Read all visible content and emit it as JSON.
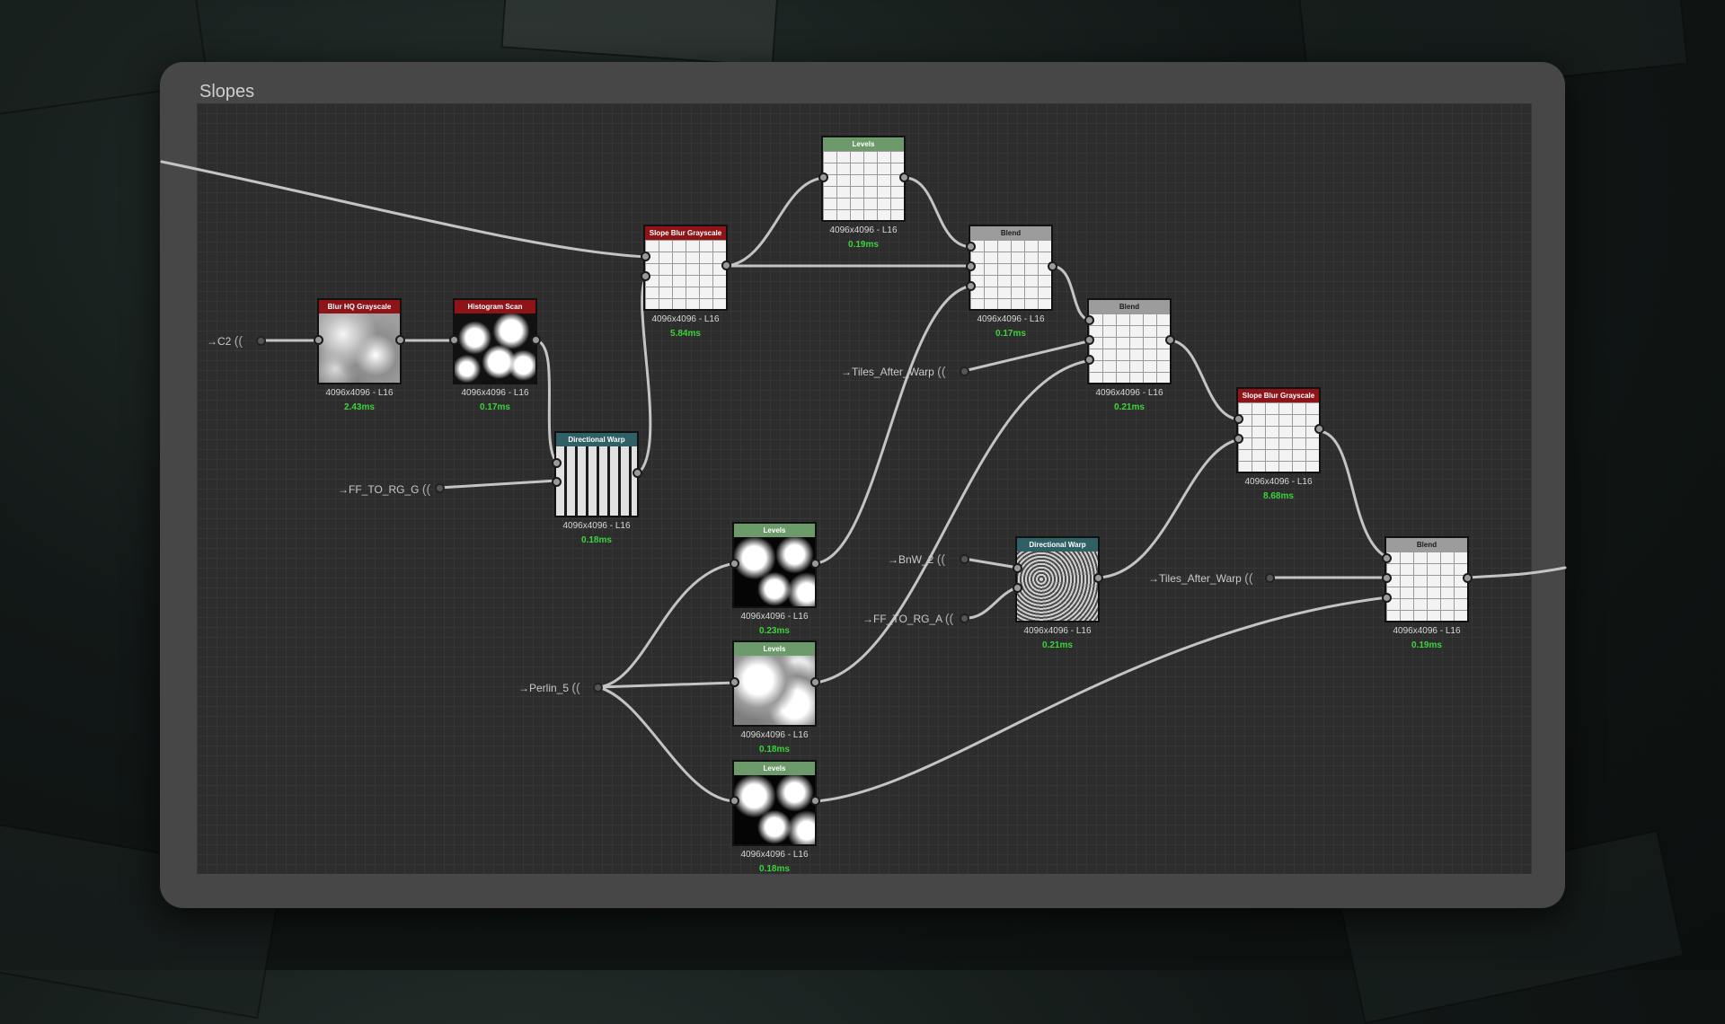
{
  "graph": {
    "title": "Slopes"
  },
  "inputs": [
    {
      "id": "c2",
      "label": "C2"
    },
    {
      "id": "ff-to-rg-g",
      "label": "FF_TO_RG_G"
    },
    {
      "id": "tiles-after-warp-1",
      "label": "Tiles_After_Warp"
    },
    {
      "id": "bnw-2",
      "label": "BnW_2"
    },
    {
      "id": "ff-to-rg-a",
      "label": "FF_TO_RG_A"
    },
    {
      "id": "perlin-5",
      "label": "Perlin_5"
    },
    {
      "id": "tiles-after-warp-2",
      "label": "Tiles_After_Warp"
    }
  ],
  "nodes": [
    {
      "id": "blur-hq",
      "title": "Blur HQ Grayscale",
      "resolution": "4096x4096 - L16",
      "time": "2.43ms",
      "header_color": "#8e1418",
      "thumbnail": "blur"
    },
    {
      "id": "histogram-scan",
      "title": "Histogram Scan",
      "resolution": "4096x4096 - L16",
      "time": "0.17ms",
      "header_color": "#8e1418",
      "thumbnail": "histogram"
    },
    {
      "id": "directional-warp-1",
      "title": "Directional Warp",
      "resolution": "4096x4096 - L16",
      "time": "0.18ms",
      "header_color": "#2f6066",
      "thumbnail": "warp"
    },
    {
      "id": "slope-blur-1",
      "title": "Slope Blur Grayscale",
      "resolution": "4096x4096 - L16",
      "time": "5.84ms",
      "header_color": "#8e1418",
      "thumbnail": "tiles"
    },
    {
      "id": "levels-top",
      "title": "Levels",
      "resolution": "4096x4096 - L16",
      "time": "0.19ms",
      "header_color": "#6c9a6a",
      "thumbnail": "tiles"
    },
    {
      "id": "blend-1",
      "title": "Blend",
      "resolution": "4096x4096 - L16",
      "time": "0.17ms",
      "header_color": "#9c9c9c",
      "thumbnail": "tiles"
    },
    {
      "id": "blend-2",
      "title": "Blend",
      "resolution": "4096x4096 - L16",
      "time": "0.21ms",
      "header_color": "#9c9c9c",
      "thumbnail": "tiles"
    },
    {
      "id": "slope-blur-2",
      "title": "Slope Blur Grayscale",
      "resolution": "4096x4096 - L16",
      "time": "8.68ms",
      "header_color": "#8e1418",
      "thumbnail": "tiles"
    },
    {
      "id": "levels-1",
      "title": "Levels",
      "resolution": "4096x4096 - L16",
      "time": "0.23ms",
      "header_color": "#6c9a6a",
      "thumbnail": "blobs"
    },
    {
      "id": "levels-2",
      "title": "Levels",
      "resolution": "4096x4096 - L16",
      "time": "0.18ms",
      "header_color": "#6c9a6a",
      "thumbnail": "soft-blobs"
    },
    {
      "id": "levels-3",
      "title": "Levels",
      "resolution": "4096x4096 - L16",
      "time": "0.18ms",
      "header_color": "#6c9a6a",
      "thumbnail": "blobs"
    },
    {
      "id": "directional-warp-2",
      "title": "Directional Warp",
      "resolution": "4096x4096 - L16",
      "time": "0.21ms",
      "header_color": "#2f6066",
      "thumbnail": "noise"
    },
    {
      "id": "blend-3",
      "title": "Blend",
      "resolution": "4096x4096 - L16",
      "time": "0.19ms",
      "header_color": "#9c9c9c",
      "thumbnail": "tiles"
    }
  ]
}
